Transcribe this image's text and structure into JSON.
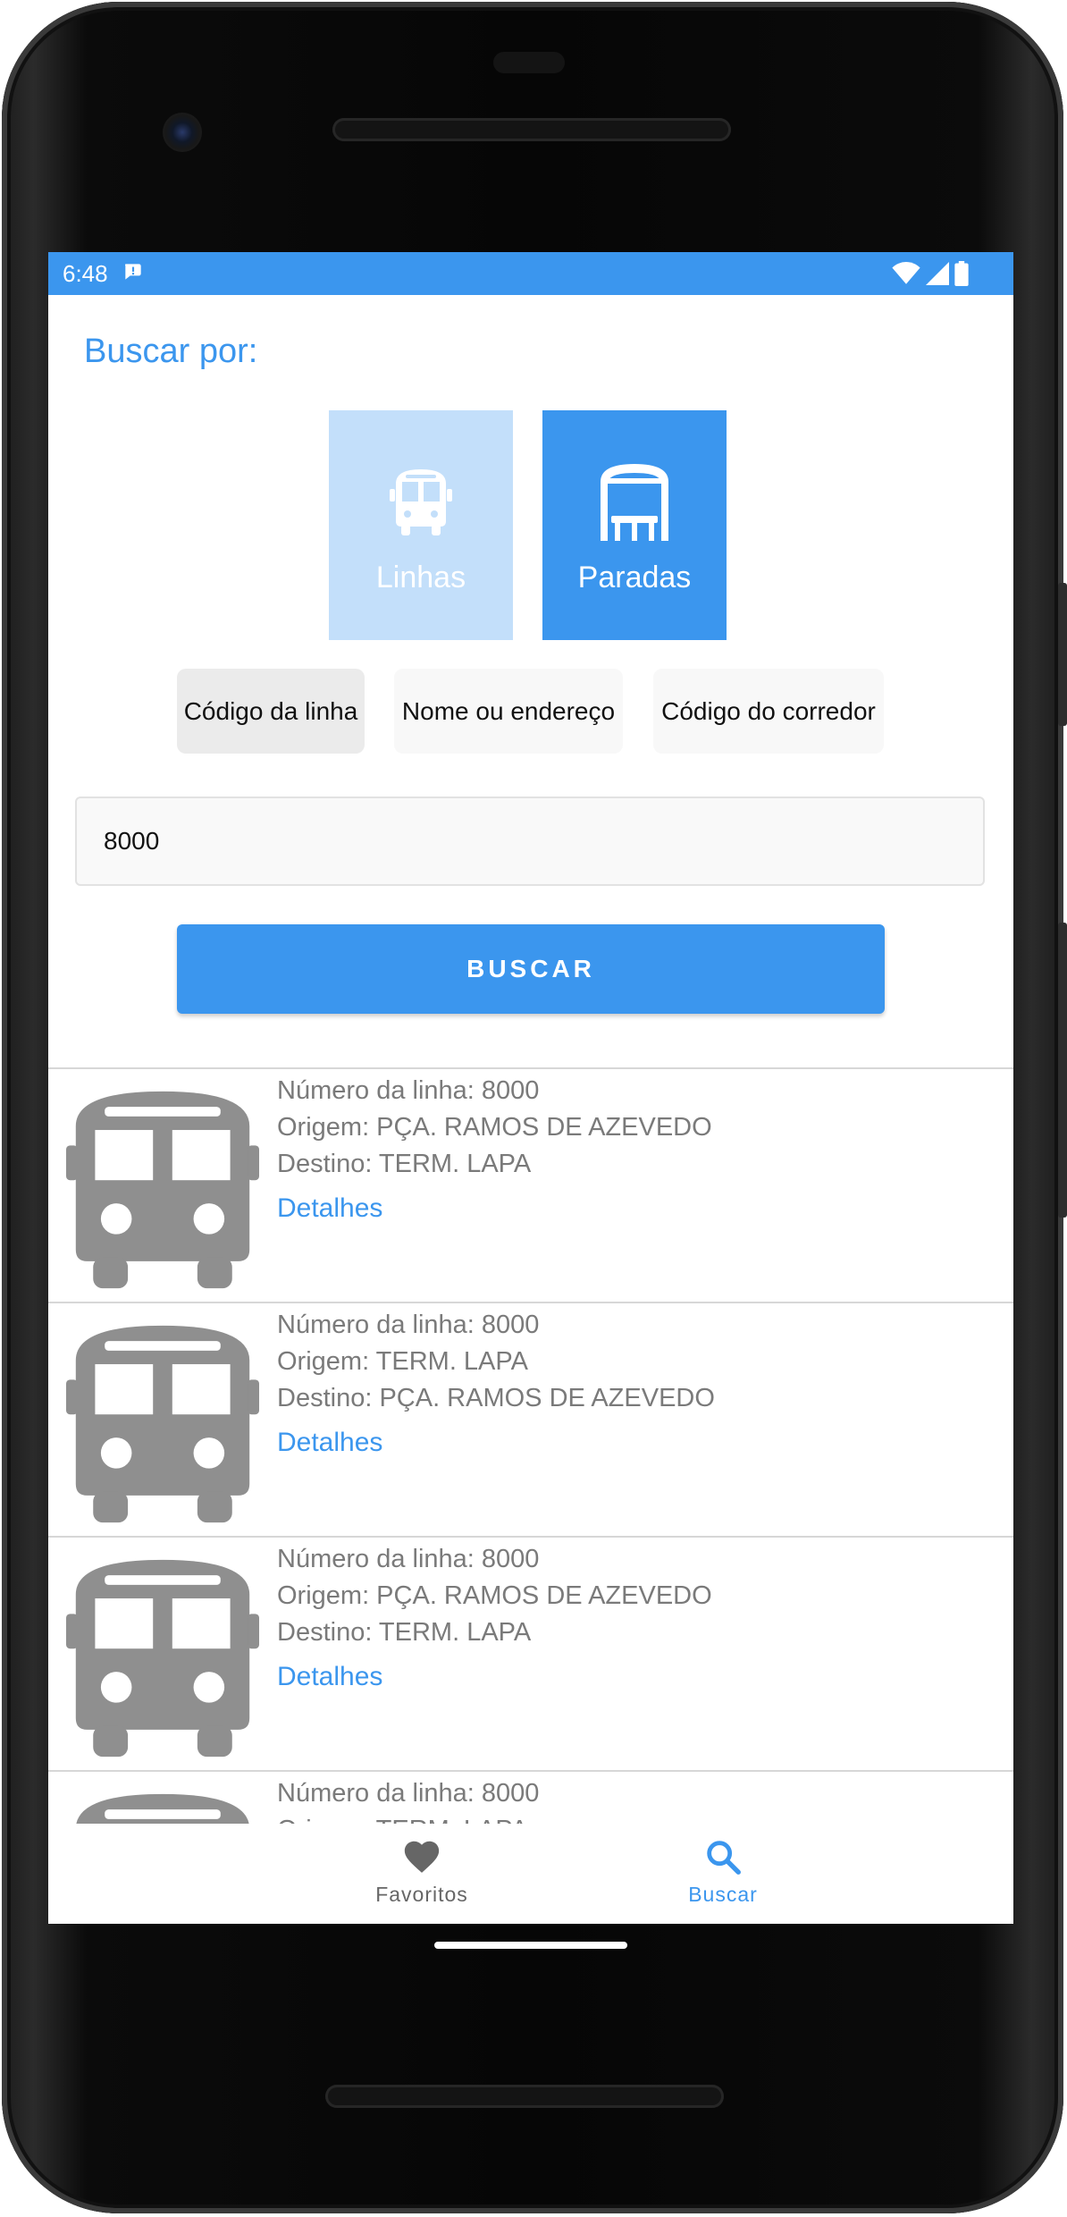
{
  "status_bar": {
    "time": "6:48"
  },
  "search": {
    "heading": "Buscar por:",
    "modes": [
      {
        "label": "Linhas",
        "icon": "bus-icon",
        "selected": false
      },
      {
        "label": "Paradas",
        "icon": "bus-stop-icon",
        "selected": true
      }
    ],
    "filters": [
      {
        "label": "Código da linha",
        "selected": true
      },
      {
        "label": "Nome ou endereço",
        "selected": false
      },
      {
        "label": "Código do corredor",
        "selected": false
      }
    ],
    "input_value": "8000",
    "button_label": "BUSCAR"
  },
  "results": [
    {
      "line": "Número da linha: 8000",
      "origin": "Origem: PÇA. RAMOS DE AZEVEDO",
      "destination": "Destino: TERM. LAPA",
      "link": "Detalhes"
    },
    {
      "line": "Número da linha: 8000",
      "origin": "Origem: TERM. LAPA",
      "destination": "Destino: PÇA. RAMOS DE AZEVEDO",
      "link": "Detalhes"
    },
    {
      "line": "Número da linha: 8000",
      "origin": "Origem: PÇA. RAMOS DE AZEVEDO",
      "destination": "Destino: TERM. LAPA",
      "link": "Detalhes"
    },
    {
      "line": "Número da linha: 8000",
      "origin": "Origem: TERM. LAPA",
      "destination": "",
      "link": ""
    }
  ],
  "bottom_nav": {
    "items": [
      {
        "label": "Favoritos",
        "icon": "heart-icon",
        "active": false
      },
      {
        "label": "Buscar",
        "icon": "search-icon",
        "active": true
      }
    ]
  },
  "colors": {
    "accent": "#3b96ee",
    "accent_light": "#c3dffa",
    "muted_text": "#7a7a7a"
  }
}
